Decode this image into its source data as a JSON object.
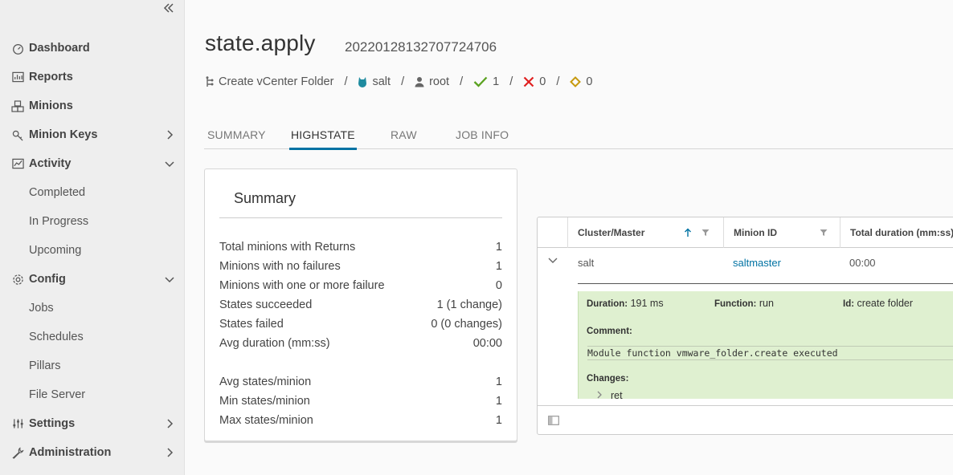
{
  "sidebar": {
    "items": [
      {
        "label": "Dashboard",
        "icon": "dashboard-icon"
      },
      {
        "label": "Reports",
        "icon": "reports-icon"
      },
      {
        "label": "Minions",
        "icon": "minions-icon"
      },
      {
        "label": "Minion Keys",
        "icon": "key-icon"
      },
      {
        "label": "Activity",
        "icon": "activity-icon"
      },
      {
        "label": "Completed"
      },
      {
        "label": "In Progress"
      },
      {
        "label": "Upcoming"
      },
      {
        "label": "Config",
        "icon": "gear-icon"
      },
      {
        "label": "Jobs"
      },
      {
        "label": "Schedules"
      },
      {
        "label": "Pillars"
      },
      {
        "label": "File Server"
      },
      {
        "label": "Settings",
        "icon": "settings-icon"
      },
      {
        "label": "Administration",
        "icon": "wrench-icon"
      }
    ]
  },
  "header": {
    "title": "state.apply",
    "jid": "20220128132707724706",
    "job_name": "Create vCenter Folder",
    "master": "salt",
    "user": "root",
    "succeeded": "1",
    "failed": "0",
    "changed": "0"
  },
  "tabs": [
    "SUMMARY",
    "HIGHSTATE",
    "RAW",
    "JOB INFO"
  ],
  "summary": {
    "title": "Summary",
    "rows": [
      {
        "label": "Total minions with Returns",
        "value": "1"
      },
      {
        "label": "Minions with no failures",
        "value": "1"
      },
      {
        "label": "Minions with one or more failure",
        "value": "0"
      },
      {
        "label": "States succeeded",
        "value": "1 (1 change)"
      },
      {
        "label": "States failed",
        "value": "0 (0 changes)"
      },
      {
        "label": "Avg duration (mm:ss)",
        "value": "00:00"
      },
      {
        "label": "Avg states/minion",
        "value": "1"
      },
      {
        "label": "Min states/minion",
        "value": "1"
      },
      {
        "label": "Max states/minion",
        "value": "1"
      }
    ]
  },
  "grid": {
    "columns": [
      "Cluster/Master",
      "Minion ID",
      "Total duration (mm:ss)"
    ],
    "row": {
      "master": "salt",
      "minion": "saltmaster",
      "duration": "00:00"
    },
    "detail": {
      "duration_label": "Duration:",
      "duration": "191 ms",
      "function_label": "Function:",
      "function": "run",
      "id_label": "Id:",
      "id": "create folder",
      "comment_label": "Comment:",
      "comment": "Module function vmware_folder.create executed",
      "changes_label": "Changes:",
      "changes_key": "ret"
    }
  },
  "colors": {
    "accent": "#0072a3",
    "success": "#5aa220",
    "error": "#e02020",
    "warning": "#c79a10",
    "detail_bg": "#dff0d0"
  }
}
